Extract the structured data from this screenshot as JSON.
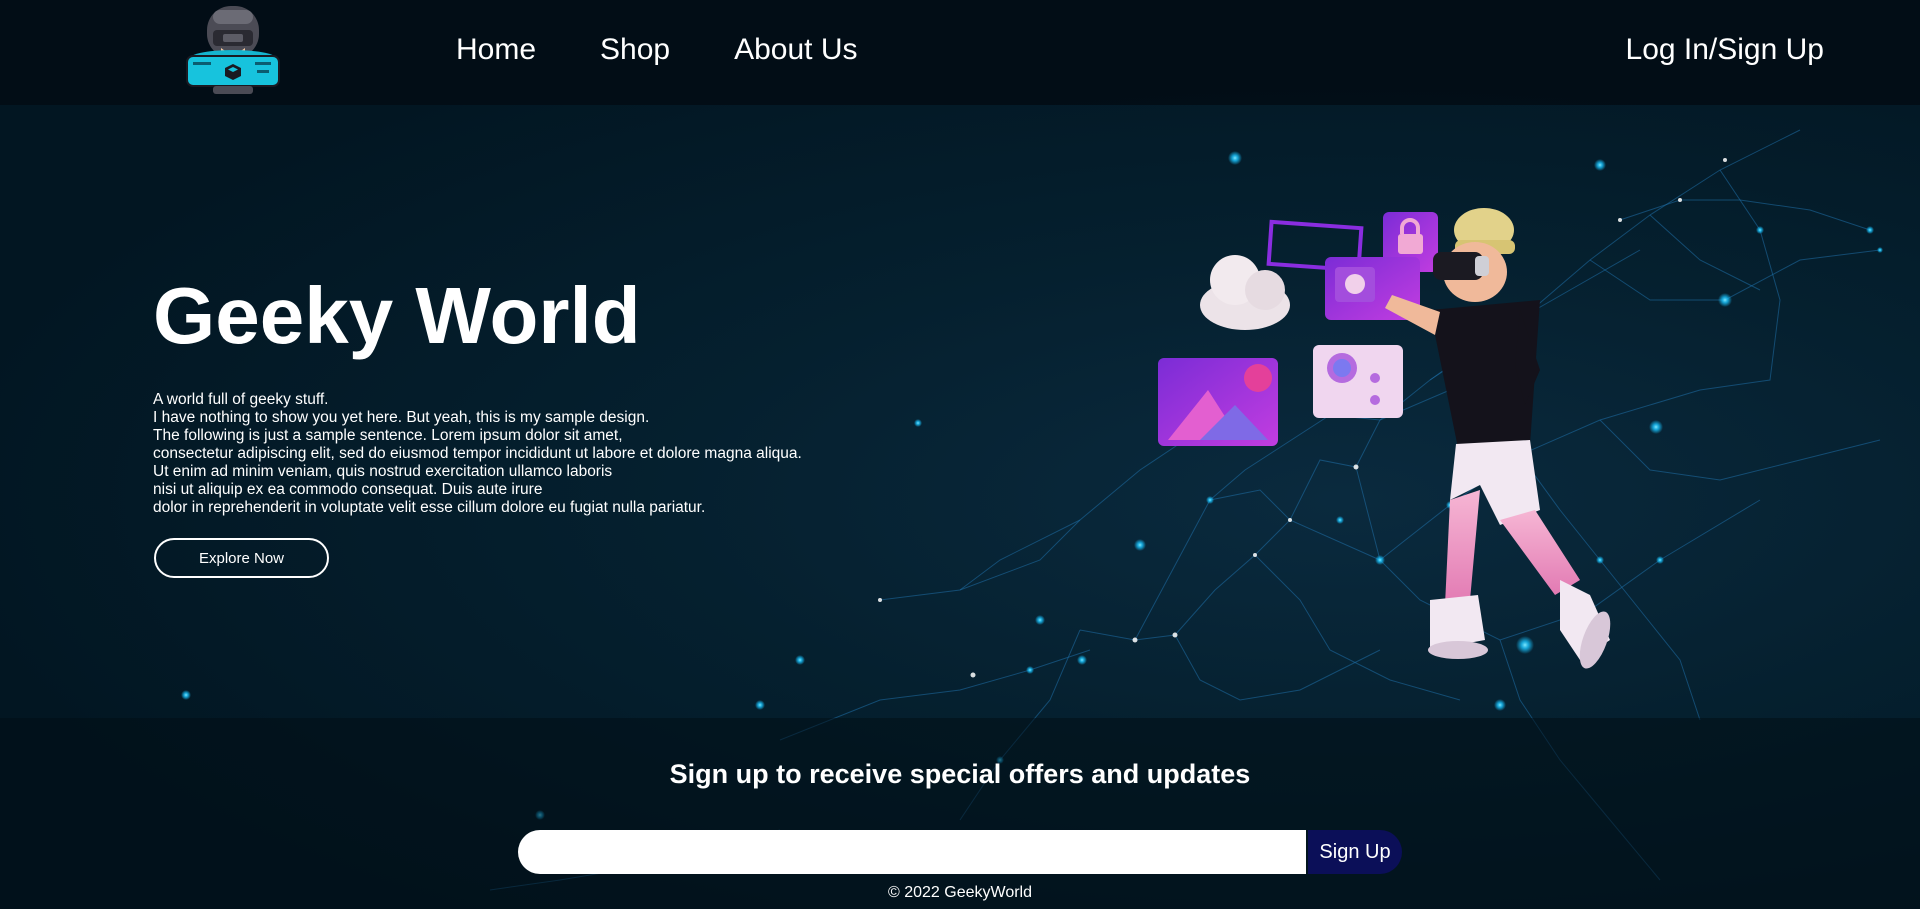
{
  "header": {
    "logo_icon": "vr-headset-avatar-logo",
    "nav": {
      "home": "Home",
      "shop": "Shop",
      "about": "About Us"
    },
    "login": "Log In/Sign Up"
  },
  "hero": {
    "title": "Geeky World",
    "lines": [
      "A world full of geeky stuff.",
      "I have nothing to show you yet here. But yeah, this is my sample design.",
      "The following is just a sample sentence. Lorem ipsum dolor sit amet,",
      "consectetur adipiscing elit, sed do eiusmod tempor incididunt ut labore et dolore magna aliqua.",
      "Ut enim ad minim veniam, quis nostrud exercitation ullamco laboris",
      "nisi ut aliquip ex ea commodo consequat. Duis aute irure",
      "dolor in reprehenderit in voluptate velit esse cillum dolore eu fugiat nulla pariatur."
    ],
    "button": "Explore Now",
    "illustration_icon": "vr-boy-illustration"
  },
  "signup": {
    "title": "Sign up to receive special offers and updates",
    "email_placeholder": "",
    "email_value": "",
    "button": "Sign Up"
  },
  "footer": {
    "copyright": "© 2022 GeekyWorld"
  },
  "colors": {
    "background": "#021622",
    "header_bg": "#020c14",
    "signup_button": "#0b0f58",
    "network_line": "#1f6fa8",
    "network_node": "#2fd0ff"
  }
}
